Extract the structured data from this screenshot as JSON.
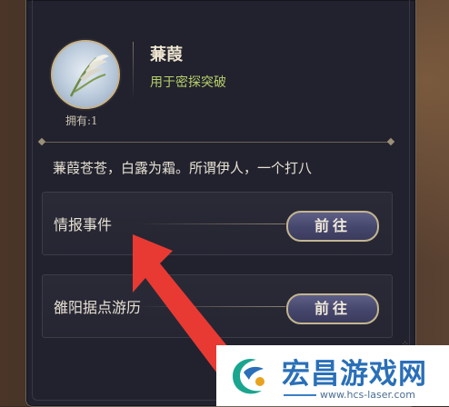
{
  "item": {
    "name": "蒹葭",
    "usage": "用于密探突破",
    "owned": "拥有:1",
    "description": "蒹葭苍苍，白露为霜。所谓伊人，一个打八"
  },
  "sources": [
    {
      "label": "情报事件",
      "button": "前往"
    },
    {
      "label": "雒阳据点游历",
      "button": "前往"
    }
  ],
  "watermark": {
    "title": "宏昌游戏网",
    "url": "www.hcs-laser.com"
  },
  "colors": {
    "arrow": "#e83a33",
    "usage_text": "#b7d06a",
    "button_border": "#c3b58f"
  }
}
